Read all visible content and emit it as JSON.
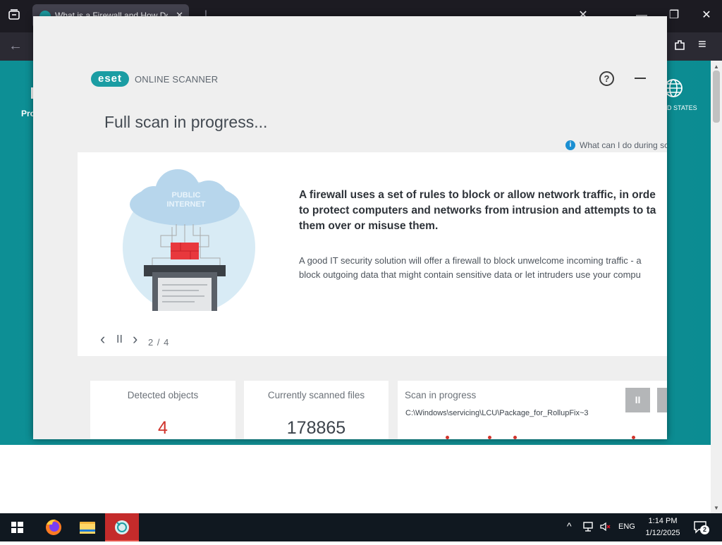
{
  "browser": {
    "tab_title": "What is a Firewall and How Do",
    "tab_close": "✕",
    "window_minimize": "—",
    "window_restore": "❐",
    "window_close": "✕",
    "back": "←",
    "extensions": "⧉",
    "menu": "≡"
  },
  "webpage": {
    "nav_left_label": "Pro",
    "region_label": "D STATES"
  },
  "scanner": {
    "brand_logo": "eset",
    "brand_product": "ONLINE SCANNER",
    "help_icon": "?",
    "title": "Full scan in progress...",
    "info_icon": "i",
    "info_link": "What can I do during sc",
    "slide": {
      "illustration_text": [
        "PUBLIC",
        "INTERNET"
      ],
      "headline_lines": [
        "A firewall uses a set of rules to block or allow network traffic, in orde",
        "to protect computers and networks from intrusion and attempts to ta",
        "them over or misuse them."
      ],
      "body_lines": [
        "A good IT security solution will offer a firewall to block unwelcome incoming traffic - a",
        "block outgoing data that might contain sensitive data or let intruders use your compu"
      ],
      "prev": "‹",
      "pause": "II",
      "next": "›",
      "counter": "2 / 4"
    },
    "stats": {
      "detected_label": "Detected objects",
      "detected_value": "4",
      "scanned_label": "Currently scanned files",
      "scanned_value": "178865",
      "progress_label": "Scan in progress",
      "progress_path": "C:\\Windows\\servicing\\LCU\\Package_for_RollupFix~3",
      "pause_btn": "II"
    },
    "colors": {
      "accent": "#1b9da3",
      "detected": "#d0342c"
    }
  },
  "taskbar": {
    "apps": [
      "firefox-icon",
      "file-explorer-icon",
      "eset-scanner-icon"
    ],
    "tray_chevron": "^",
    "lang": "ENG",
    "time": "1:14 PM",
    "date": "1/12/2025",
    "notifications_count": "2"
  }
}
